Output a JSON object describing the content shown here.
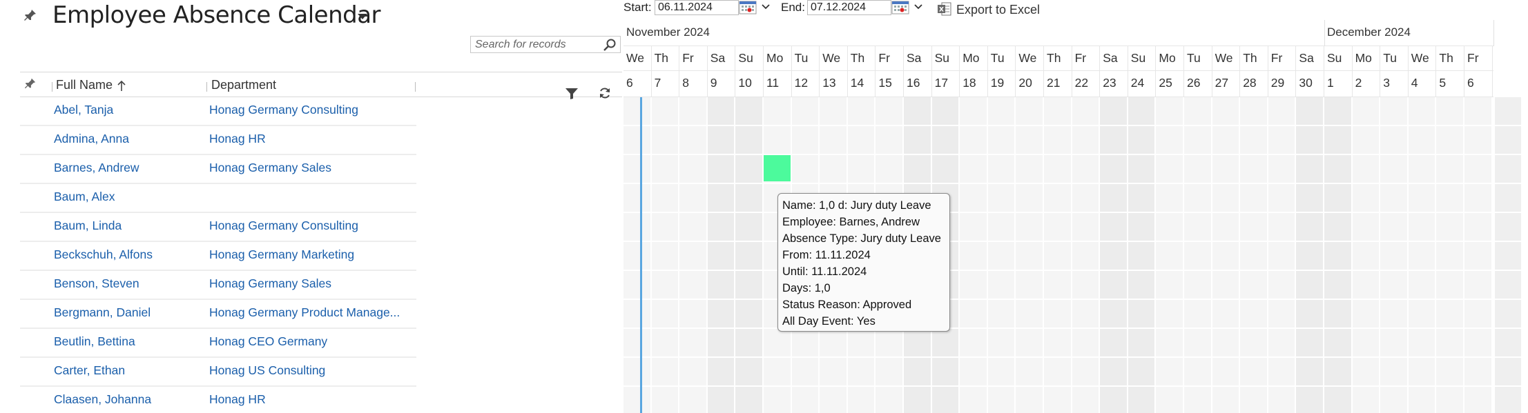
{
  "header": {
    "title": "Employee Absence Calendar",
    "search_placeholder": "Search for records"
  },
  "grid": {
    "columns": [
      "Full Name",
      "Department"
    ],
    "sort_column": "Full Name",
    "sort_direction": "ascending",
    "rows": [
      {
        "name": "Abel, Tanja",
        "department": "Honag Germany Consulting"
      },
      {
        "name": "Admina, Anna",
        "department": "Honag HR"
      },
      {
        "name": "Barnes, Andrew",
        "department": "Honag Germany Sales"
      },
      {
        "name": "Baum, Alex",
        "department": ""
      },
      {
        "name": "Baum, Linda",
        "department": "Honag Germany Consulting"
      },
      {
        "name": "Beckschuh, Alfons",
        "department": "Honag Germany Marketing"
      },
      {
        "name": "Benson, Steven",
        "department": "Honag Germany Sales"
      },
      {
        "name": "Bergmann, Daniel",
        "department": "Honag Germany Product Manage..."
      },
      {
        "name": "Beutlin, Bettina",
        "department": "Honag CEO Germany"
      },
      {
        "name": "Carter, Ethan",
        "department": "Honag US Consulting"
      },
      {
        "name": "Claasen, Johanna",
        "department": "Honag HR"
      }
    ]
  },
  "toolbar": {
    "start_label": "Start:",
    "start_value": "06.11.2024",
    "end_label": "End:",
    "end_value": "07.12.2024",
    "export_label": "Export to Excel"
  },
  "calendar": {
    "months": [
      {
        "label": "November 2024",
        "start_index": 0
      },
      {
        "label": "December 2024",
        "start_index": 25
      }
    ],
    "days": [
      {
        "dow": "We",
        "dom": "6"
      },
      {
        "dow": "Th",
        "dom": "7"
      },
      {
        "dow": "Fr",
        "dom": "8"
      },
      {
        "dow": "Sa",
        "dom": "9"
      },
      {
        "dow": "Su",
        "dom": "10"
      },
      {
        "dow": "Mo",
        "dom": "11"
      },
      {
        "dow": "Tu",
        "dom": "12"
      },
      {
        "dow": "We",
        "dom": "13"
      },
      {
        "dow": "Th",
        "dom": "14"
      },
      {
        "dow": "Fr",
        "dom": "15"
      },
      {
        "dow": "Sa",
        "dom": "16"
      },
      {
        "dow": "Su",
        "dom": "17"
      },
      {
        "dow": "Mo",
        "dom": "18"
      },
      {
        "dow": "Tu",
        "dom": "19"
      },
      {
        "dow": "We",
        "dom": "20"
      },
      {
        "dow": "Th",
        "dom": "21"
      },
      {
        "dow": "Fr",
        "dom": "22"
      },
      {
        "dow": "Sa",
        "dom": "23"
      },
      {
        "dow": "Su",
        "dom": "24"
      },
      {
        "dow": "Mo",
        "dom": "25"
      },
      {
        "dow": "Tu",
        "dom": "26"
      },
      {
        "dow": "We",
        "dom": "27"
      },
      {
        "dow": "Th",
        "dom": "28"
      },
      {
        "dow": "Fr",
        "dom": "29"
      },
      {
        "dow": "Sa",
        "dom": "30"
      },
      {
        "dow": "Su",
        "dom": "1"
      },
      {
        "dow": "Mo",
        "dom": "2"
      },
      {
        "dow": "Tu",
        "dom": "3"
      },
      {
        "dow": "We",
        "dom": "4"
      },
      {
        "dow": "Th",
        "dom": "5"
      },
      {
        "dow": "Fr",
        "dom": "6"
      }
    ],
    "absences": [
      {
        "employee": "Barnes, Andrew",
        "date": "11.11.2024",
        "days": 1,
        "color": "#4cfa9c"
      }
    ],
    "colors": {
      "weekend": "#ececec",
      "workday": "#f5f5f5",
      "absence": "#4cfa9c",
      "today_line": "#5aa6e0"
    }
  },
  "tooltip": {
    "lines": [
      "Name: 1,0 d: Jury duty Leave",
      "Employee: Barnes, Andrew",
      "Absence Type: Jury duty Leave",
      "From: 11.11.2024",
      "Until: 11.11.2024",
      "Days: 1,0",
      "Status Reason: Approved",
      "All Day Event: Yes"
    ]
  }
}
